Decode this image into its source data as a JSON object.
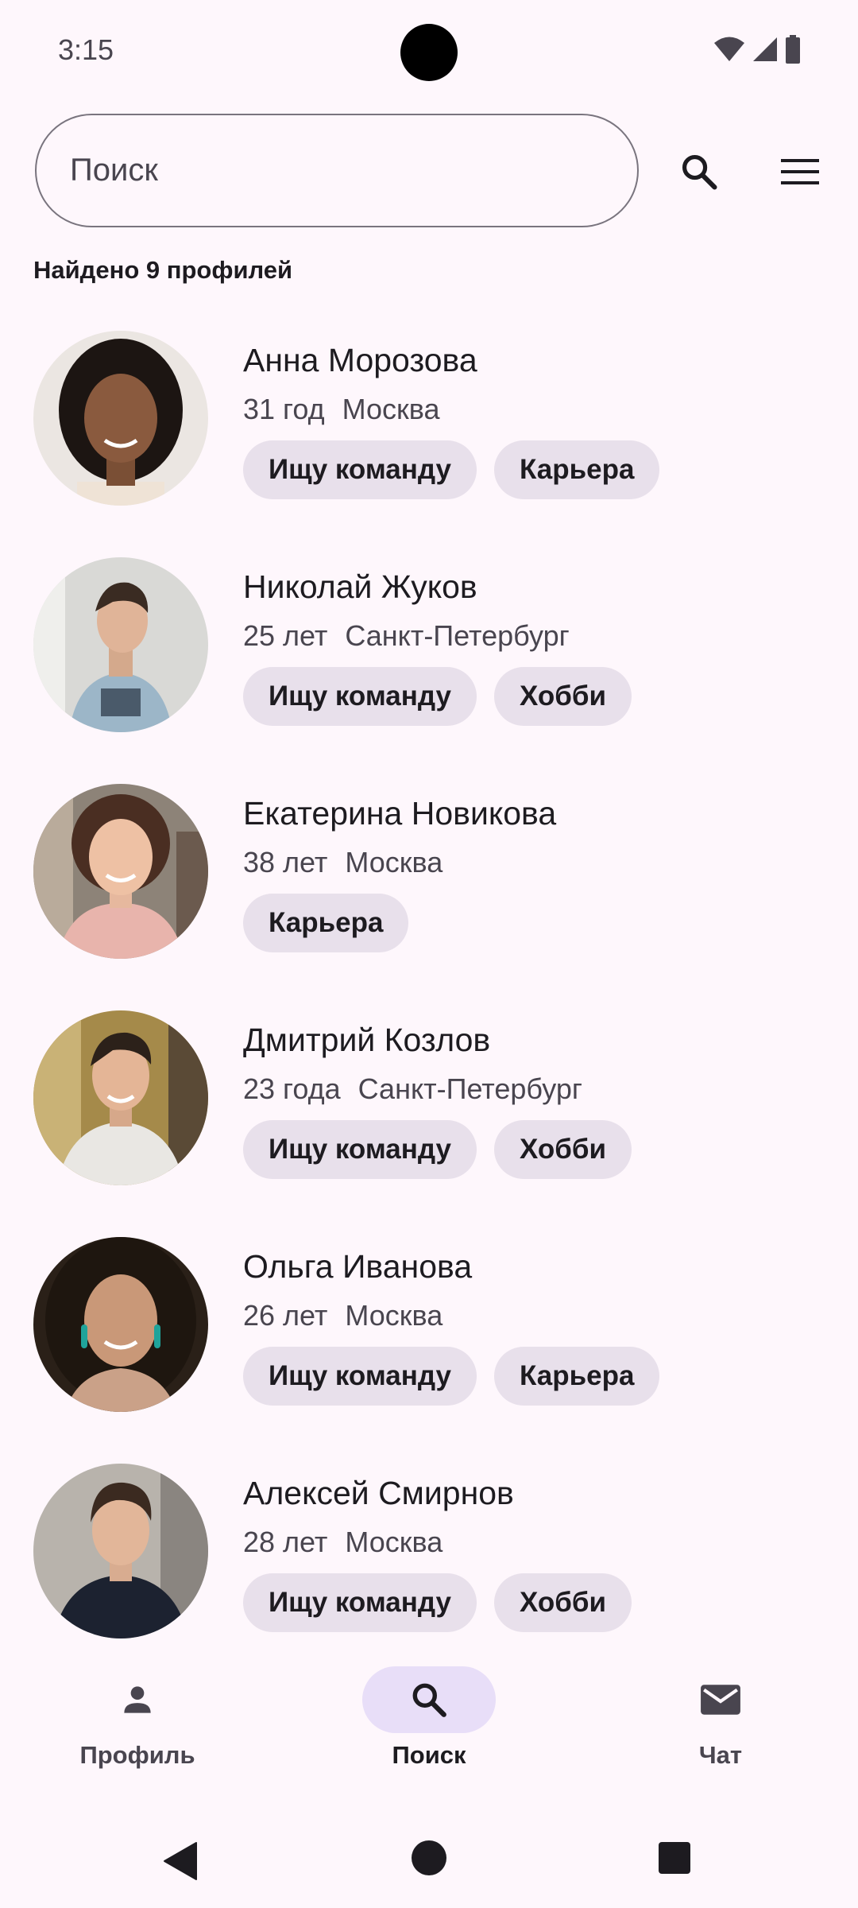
{
  "status_bar": {
    "time": "3:15",
    "icons": [
      "wifi-icon",
      "signal-icon",
      "battery-icon"
    ]
  },
  "header": {
    "search_placeholder": "Поиск",
    "search_icon": "search-icon",
    "menu_icon": "menu-icon"
  },
  "result_count": "Найдено 9 профилей",
  "profiles": [
    {
      "name": "Анна Морозова",
      "age": "31 год",
      "city": "Москва",
      "tags": [
        "Ищу команду",
        "Карьера"
      ]
    },
    {
      "name": "Николай Жуков",
      "age": "25 лет",
      "city": "Санкт-Петербург",
      "tags": [
        "Ищу команду",
        "Хобби"
      ]
    },
    {
      "name": "Екатерина Новикова",
      "age": "38 лет",
      "city": "Москва",
      "tags": [
        "Карьера"
      ]
    },
    {
      "name": "Дмитрий Козлов",
      "age": "23 года",
      "city": "Санкт-Петербург",
      "tags": [
        "Ищу команду",
        "Хобби"
      ]
    },
    {
      "name": "Ольга Иванова",
      "age": "26 лет",
      "city": "Москва",
      "tags": [
        "Ищу команду",
        "Карьера"
      ]
    },
    {
      "name": "Алексей Смирнов",
      "age": "28 лет",
      "city": "Москва",
      "tags": [
        "Ищу команду",
        "Хобби"
      ]
    }
  ],
  "bottom_nav": {
    "items": [
      {
        "label": "Профиль",
        "icon": "person-icon",
        "active": false
      },
      {
        "label": "Поиск",
        "icon": "search-icon",
        "active": true
      },
      {
        "label": "Чат",
        "icon": "mail-icon",
        "active": false
      }
    ]
  },
  "system_nav": [
    "back-icon",
    "home-icon",
    "recents-icon"
  ],
  "colors": {
    "background": "#fef7fc",
    "chip": "#e8e0eb",
    "active_indicator": "#e8def8",
    "text_primary": "#1d1b20",
    "text_secondary": "#49454f"
  }
}
